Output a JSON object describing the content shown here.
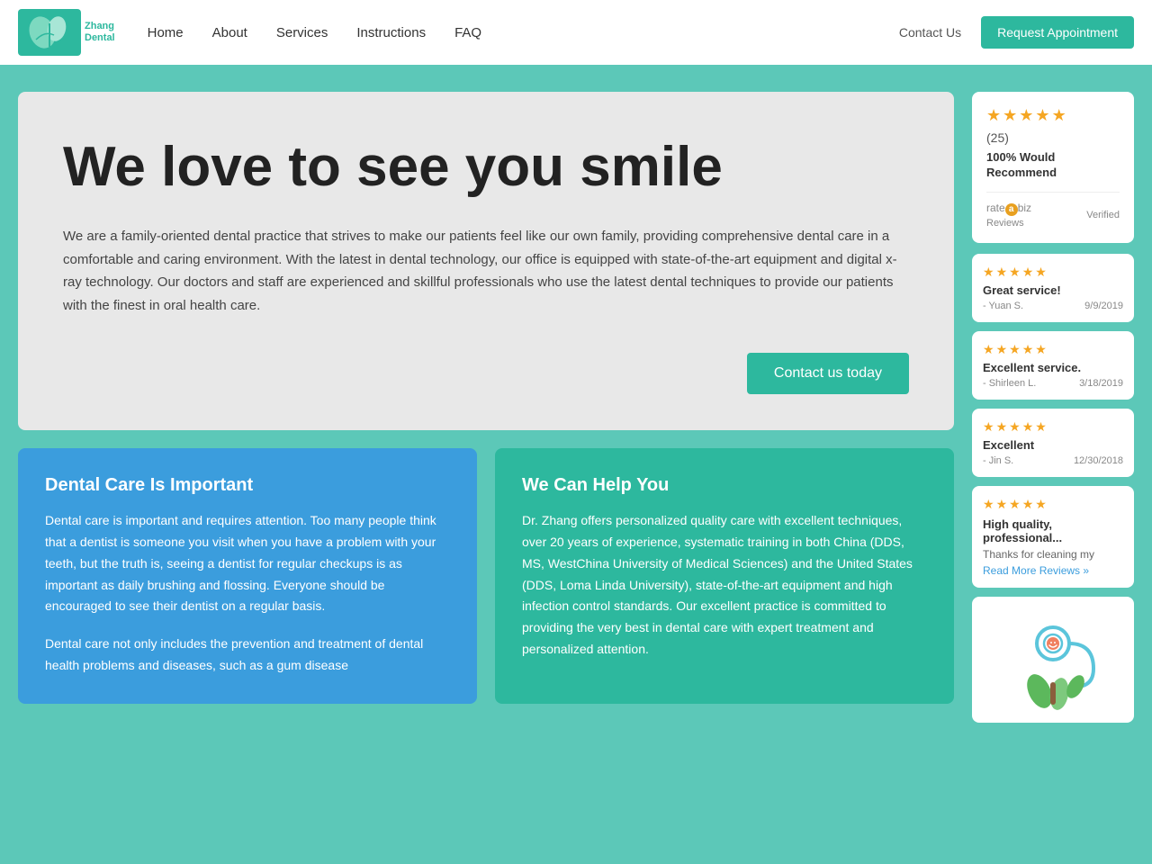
{
  "navbar": {
    "logo_alt": "Zhang Dental",
    "logo_line1": "Zhang",
    "logo_line2": "Dental",
    "links": [
      {
        "label": "Home",
        "id": "home"
      },
      {
        "label": "About",
        "id": "about"
      },
      {
        "label": "Services",
        "id": "services"
      },
      {
        "label": "Instructions",
        "id": "instructions"
      },
      {
        "label": "FAQ",
        "id": "faq"
      }
    ],
    "contact_label": "Contact Us",
    "appointment_label": "Request Appointment"
  },
  "hero": {
    "title": "We love to see you smile",
    "description": "We are a family-oriented dental practice that strives to make our patients feel like our own family, providing comprehensive dental care in a comfortable and caring environment. With the latest in dental technology, our office is equipped with state-of-the-art equipment and digital x-ray technology. Our doctors and staff are experienced and skillful professionals who use the latest dental techniques to provide our patients with the finest in oral health care.",
    "cta_label": "Contact us today"
  },
  "info_cards": [
    {
      "id": "dental-care",
      "title": "Dental Care Is Important",
      "body": "Dental care is important and requires attention. Too many people think that a dentist is someone you visit when you have a problem with your teeth, but the truth is, seeing a dentist for regular checkups is as important as daily brushing and flossing. Everyone should be encouraged to see their dentist on a regular basis.",
      "body2": "Dental care not only includes the prevention and treatment of dental health problems and diseases, such as a gum disease"
    },
    {
      "id": "help-you",
      "title": "We Can Help You",
      "body": "Dr. Zhang offers personalized quality care with excellent techniques, over 20 years of experience, systematic training in both China (DDS, MS, WestChina University of Medical Sciences) and the United States (DDS, Loma Linda University), state-of-the-art equipment and high infection control standards. Our excellent practice is committed to providing the very best in dental care with expert treatment and personalized attention."
    }
  ],
  "reviews_widget": {
    "stars": 5,
    "count": "(25)",
    "recommend": "100% Would Recommend",
    "ratebiz_label": "rate",
    "ratebiz_a": "a",
    "ratebiz_biz": "biz",
    "verified": "Verified",
    "reviews_word": "Reviews"
  },
  "reviews": [
    {
      "stars": 5,
      "title": "Great service!",
      "author": "- Yuan S.",
      "date": "9/9/2019"
    },
    {
      "stars": 5,
      "title": "Excellent service.",
      "author": "- Shirleen L.",
      "date": "3/18/2019"
    },
    {
      "stars": 5,
      "title": "Excellent",
      "author": "- Jin S.",
      "date": "12/30/2018"
    },
    {
      "stars": 5,
      "title": "High quality, professional...",
      "snippet": "Thanks for cleaning my",
      "read_more": "Read More Reviews »"
    }
  ]
}
